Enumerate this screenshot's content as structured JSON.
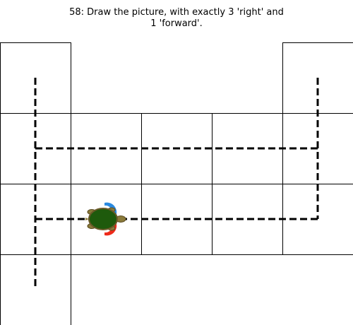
{
  "puzzle": {
    "title_line1": "58: Draw the picture, with exactly 3 'right' and",
    "title_line2": "1 'forward'."
  },
  "colors": {
    "grid_line": "#000000",
    "path_line": "#000000",
    "turtle_shell": "#1e5a0c",
    "turtle_shell_rim": "#6b5a2a",
    "turtle_body": "#8a7a3a",
    "arc_blue": "#2a8ae0",
    "arc_red": "#ee2a1a"
  },
  "icons": {
    "turtle": "turtle-icon",
    "left_arc": "rotate-left-arc",
    "right_arc": "rotate-right-arc"
  }
}
